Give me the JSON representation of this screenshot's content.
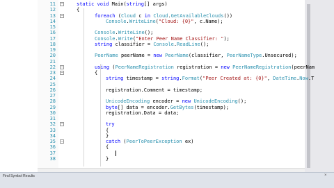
{
  "lines": [
    {
      "n": "11",
      "i": 0,
      "t": [
        [
          "kw",
          "static "
        ],
        [
          "kw",
          "void "
        ],
        [
          "pl",
          "Main("
        ],
        [
          "kw",
          "string"
        ],
        [
          "pl",
          "[] args)"
        ]
      ]
    },
    {
      "n": "12",
      "i": 0,
      "t": [
        [
          "pl",
          "{"
        ]
      ]
    },
    {
      "n": "13",
      "i": 1,
      "t": [
        [
          "kw",
          "foreach "
        ],
        [
          "pl",
          "("
        ],
        [
          "ty",
          "Cloud "
        ],
        [
          "pl",
          "c "
        ],
        [
          "kw",
          "in "
        ],
        [
          "ty",
          "Cloud"
        ],
        [
          "pl",
          "."
        ],
        [
          "ty",
          "GetAvailableClouds"
        ],
        [
          "pl",
          "())"
        ]
      ]
    },
    {
      "n": "14",
      "i": 2,
      "t": [
        [
          "ty",
          "Console"
        ],
        [
          "pl",
          "."
        ],
        [
          "ty",
          "WriteLine"
        ],
        [
          "pl",
          "("
        ],
        [
          "st",
          "\"Cloud: {0}\""
        ],
        [
          "pl",
          ", c.Name);"
        ]
      ]
    },
    {
      "n": "15",
      "i": 0,
      "t": []
    },
    {
      "n": "16",
      "i": 1,
      "t": [
        [
          "ty",
          "Console"
        ],
        [
          "pl",
          "."
        ],
        [
          "ty",
          "WriteLine"
        ],
        [
          "pl",
          "();"
        ]
      ]
    },
    {
      "n": "17",
      "i": 1,
      "t": [
        [
          "ty",
          "Console"
        ],
        [
          "pl",
          "."
        ],
        [
          "ty",
          "Write"
        ],
        [
          "pl",
          "("
        ],
        [
          "st",
          "\"Enter Peer Name Classifier: \""
        ],
        [
          "pl",
          ");"
        ]
      ]
    },
    {
      "n": "18",
      "i": 1,
      "t": [
        [
          "kw",
          "string "
        ],
        [
          "pl",
          "classifier = "
        ],
        [
          "ty",
          "Console"
        ],
        [
          "pl",
          "."
        ],
        [
          "ty",
          "ReadLine"
        ],
        [
          "pl",
          "();"
        ]
      ]
    },
    {
      "n": "19",
      "i": 0,
      "t": []
    },
    {
      "n": "20",
      "i": 1,
      "t": [
        [
          "ty",
          "PeerName "
        ],
        [
          "pl",
          "peerName = "
        ],
        [
          "kw",
          "new "
        ],
        [
          "ty",
          "PeerName"
        ],
        [
          "pl",
          "(classifier, "
        ],
        [
          "ty",
          "PeerNameType"
        ],
        [
          "pl",
          ".Unsecured);"
        ]
      ]
    },
    {
      "n": "21",
      "i": 0,
      "t": []
    },
    {
      "n": "22",
      "i": 1,
      "t": [
        [
          "kw",
          "using "
        ],
        [
          "pl",
          "("
        ],
        [
          "ty",
          "PeerNameRegistration "
        ],
        [
          "pl",
          "registration = "
        ],
        [
          "kw",
          "new "
        ],
        [
          "ty",
          "PeerNameRegistration"
        ],
        [
          "pl",
          "(peerNam"
        ]
      ]
    },
    {
      "n": "23",
      "i": 1,
      "t": [
        [
          "pl",
          "{"
        ]
      ]
    },
    {
      "n": "24",
      "i": 2,
      "t": [
        [
          "kw",
          "string "
        ],
        [
          "pl",
          "timestamp = "
        ],
        [
          "kw",
          "string"
        ],
        [
          "pl",
          "."
        ],
        [
          "ty",
          "Format"
        ],
        [
          "pl",
          "("
        ],
        [
          "st",
          "\"Peer Created at: {0}\""
        ],
        [
          "pl",
          ", "
        ],
        [
          "ty",
          "DateTime"
        ],
        [
          "pl",
          "."
        ],
        [
          "ty",
          "Now"
        ],
        [
          "pl",
          ".T"
        ]
      ]
    },
    {
      "n": "25",
      "i": 0,
      "t": []
    },
    {
      "n": "26",
      "i": 2,
      "t": [
        [
          "pl",
          "registration.Comment = timestamp;"
        ]
      ]
    },
    {
      "n": "27",
      "i": 0,
      "t": []
    },
    {
      "n": "28",
      "i": 2,
      "t": [
        [
          "ty",
          "UnicodeEncoding "
        ],
        [
          "pl",
          "encoder = "
        ],
        [
          "kw",
          "new "
        ],
        [
          "ty",
          "UnicodeEncoding"
        ],
        [
          "pl",
          "();"
        ]
      ]
    },
    {
      "n": "29",
      "i": 2,
      "t": [
        [
          "kw",
          "byte"
        ],
        [
          "pl",
          "[] data = encoder."
        ],
        [
          "ty",
          "GetBytes"
        ],
        [
          "pl",
          "(timestamp);"
        ]
      ]
    },
    {
      "n": "30",
      "i": 2,
      "t": [
        [
          "pl",
          "registration.Data = data;"
        ]
      ]
    },
    {
      "n": "31",
      "i": 0,
      "t": []
    },
    {
      "n": "32",
      "i": 2,
      "t": [
        [
          "kw",
          "try"
        ]
      ]
    },
    {
      "n": "33",
      "i": 2,
      "t": [
        [
          "pl",
          "{"
        ]
      ]
    },
    {
      "n": "34",
      "i": 2,
      "t": [
        [
          "pl",
          "}"
        ]
      ]
    },
    {
      "n": "35",
      "i": 2,
      "t": [
        [
          "kw",
          "catch "
        ],
        [
          "pl",
          "("
        ],
        [
          "ty",
          "PeerToPeerException "
        ],
        [
          "pl",
          "ex)"
        ]
      ]
    },
    {
      "n": "36",
      "i": 2,
      "t": [
        [
          "pl",
          "{"
        ]
      ]
    },
    {
      "n": "37",
      "i": 0,
      "t": []
    },
    {
      "n": "38",
      "i": 2,
      "t": [
        [
          "pl",
          "}"
        ]
      ]
    }
  ],
  "status": {
    "title": "Find Symbol Results",
    "close": "×"
  },
  "colors": {
    "keyword": "#0000ff",
    "type": "#2b91af",
    "string": "#a31515",
    "line_number": "#2b91af"
  },
  "icons": {
    "fold_open": "minus-icon"
  }
}
